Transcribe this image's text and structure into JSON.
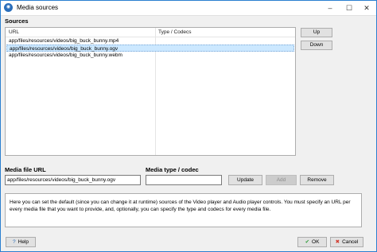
{
  "window": {
    "title": "Media sources"
  },
  "sources": {
    "label": "Sources",
    "columns": [
      "URL",
      "Type / Codecs"
    ],
    "rows": [
      {
        "url": "app/files/resources/videos/big_buck_bunny.mp4",
        "type": ""
      },
      {
        "url": "app/files/resources/videos/big_buck_bunny.ogv",
        "type": ""
      },
      {
        "url": "app/files/resources/videos/big_buck_bunny.webm",
        "type": ""
      }
    ],
    "selected_index": 1,
    "up_label": "Up",
    "down_label": "Down"
  },
  "media_file": {
    "label": "Media file URL",
    "value": "app/files/resources/videos/big_buck_bunny.ogv"
  },
  "media_type": {
    "label": "Media type / codec",
    "value": ""
  },
  "actions": {
    "update": "Update",
    "add": "Add",
    "remove": "Remove"
  },
  "info_text": "Here you can set the default (since you can change it at runtime) sources of the Video player and Audio player controls. You must specify an URL per every media file that you want to provide, and, optionally, you can specify the type and codecs for every media file.",
  "footer": {
    "help": "Help",
    "ok": "OK",
    "cancel": "Cancel"
  },
  "colors": {
    "selection": "#cce8ff",
    "accent": "#2b7fd0",
    "ok_green": "#2e9e3a",
    "cancel_red": "#d23a2e"
  }
}
